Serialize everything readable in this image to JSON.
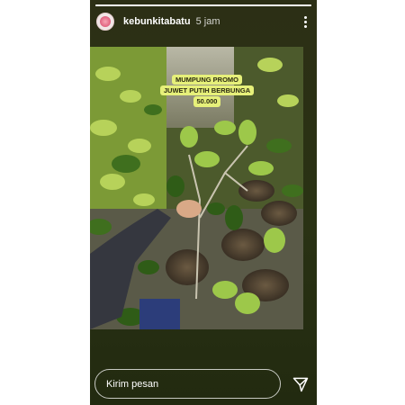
{
  "story": {
    "username": "kebunkitabatu",
    "time_ago": "5 jam",
    "progress": 1.0
  },
  "post_image": {
    "promo_lines": [
      "MUMPUNG PROMO",
      "JUWET PUTIH BERBUNGA",
      "50.000"
    ]
  },
  "reply": {
    "placeholder": "Kirim pesan"
  },
  "icons": {
    "avatar": "flower-avatar-icon",
    "more": "more-vertical-icon",
    "send": "send-icon"
  },
  "colors": {
    "background": "#2a3214",
    "promo_label_bg": "#e6f07a"
  }
}
